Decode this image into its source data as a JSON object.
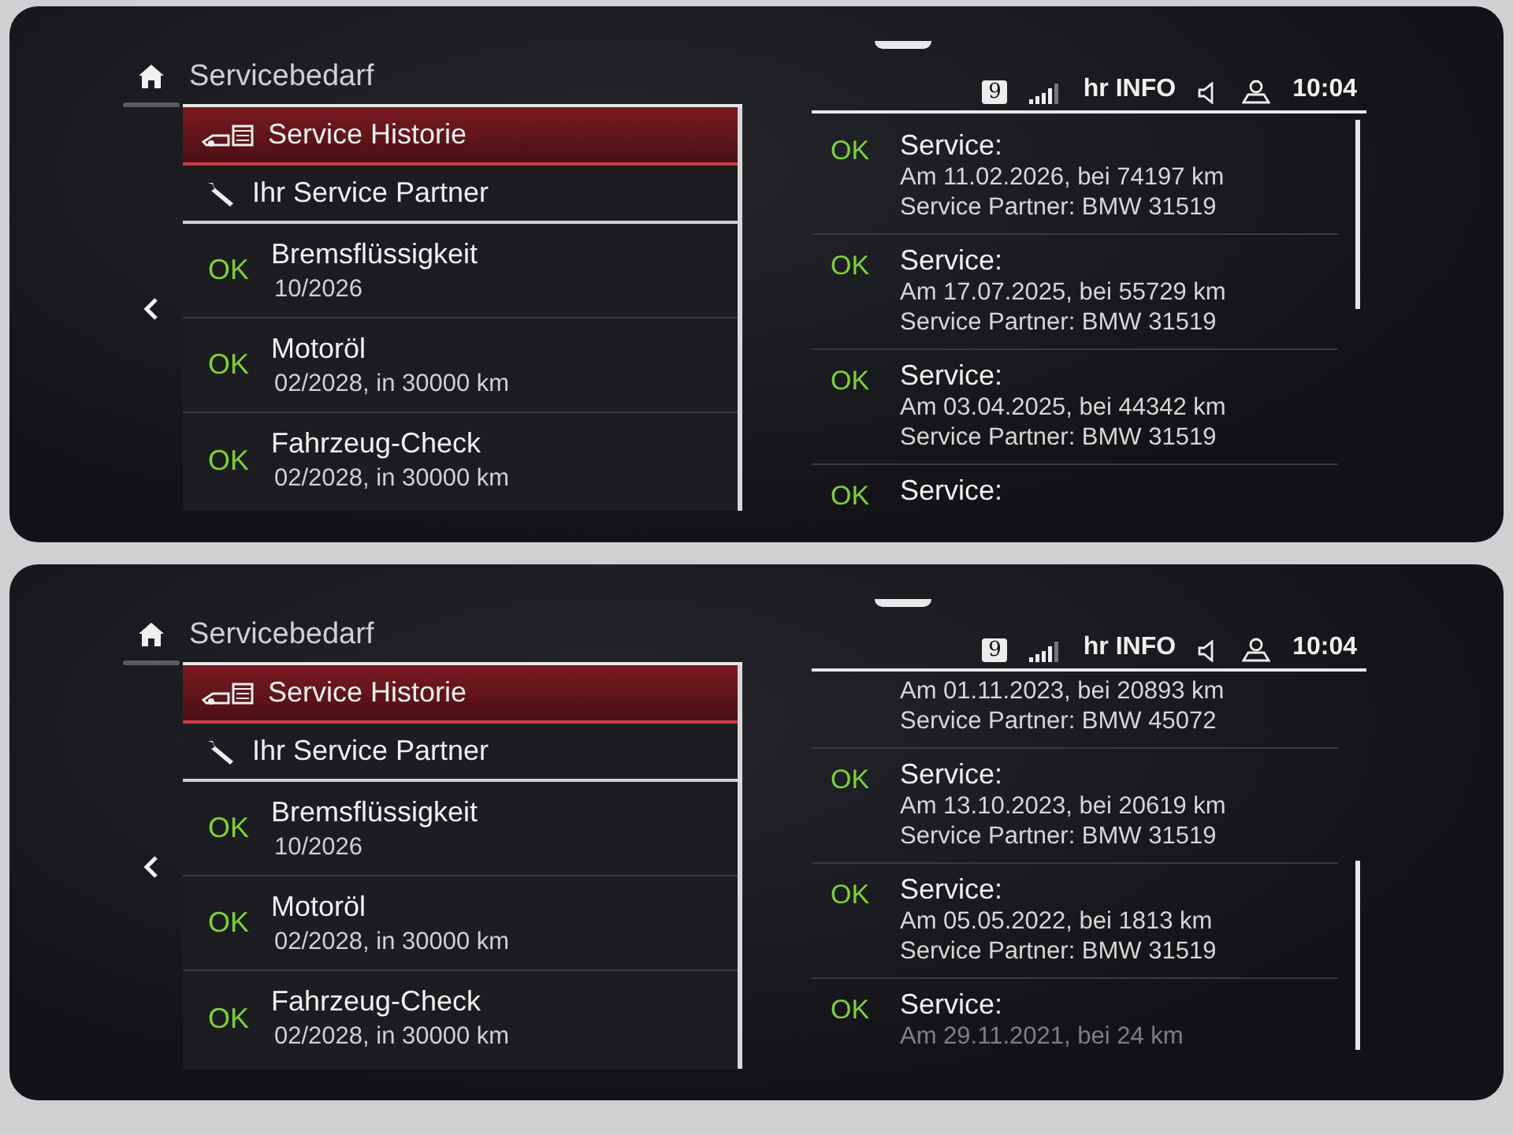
{
  "screens": [
    {
      "title": "Servicebedarf",
      "status_bar": {
        "channel": "9",
        "station": "hr INFO",
        "time": "10:04"
      },
      "menu": [
        {
          "label": "Service Historie",
          "kind": "history",
          "selected": true
        },
        {
          "label": "Ihr Service Partner",
          "kind": "partner",
          "selected": false
        }
      ],
      "services": [
        {
          "status": "OK",
          "name": "Bremsflüssigkeit",
          "due": "10/2026"
        },
        {
          "status": "OK",
          "name": "Motoröl",
          "due": "02/2028, in 30000 km"
        },
        {
          "status": "OK",
          "name": "Fahrzeug-Check",
          "due": "02/2028, in 30000 km"
        }
      ],
      "history": [
        {
          "status": "OK",
          "title": "Service:",
          "lines": [
            "Am 11.02.2026, bei 74197 km",
            "Service Partner: BMW 31519"
          ]
        },
        {
          "status": "OK",
          "title": "Service:",
          "lines": [
            "Am 17.07.2025, bei 55729 km",
            "Service Partner: BMW 31519"
          ]
        },
        {
          "status": "OK",
          "title": "Service:",
          "lines": [
            "Am 03.04.2025, bei 44342 km",
            "Service Partner: BMW 31519"
          ]
        },
        {
          "status": "OK",
          "title": "Service:"
        }
      ]
    },
    {
      "title": "Servicebedarf",
      "status_bar": {
        "channel": "9",
        "station": "hr INFO",
        "time": "10:04"
      },
      "menu": [
        {
          "label": "Service Historie",
          "kind": "history",
          "selected": true
        },
        {
          "label": "Ihr Service Partner",
          "kind": "partner",
          "selected": false
        }
      ],
      "services": [
        {
          "status": "OK",
          "name": "Bremsflüssigkeit",
          "due": "10/2026"
        },
        {
          "status": "OK",
          "name": "Motoröl",
          "due": "02/2028, in 30000 km"
        },
        {
          "status": "OK",
          "name": "Fahrzeug-Check",
          "due": "02/2028, in 30000 km"
        }
      ],
      "history": [
        {
          "lines": [
            "Am 01.11.2023, bei 20893 km",
            "Service Partner: BMW 45072"
          ]
        },
        {
          "status": "OK",
          "title": "Service:",
          "lines": [
            "Am 13.10.2023, bei 20619 km",
            "Service Partner: BMW 31519"
          ]
        },
        {
          "status": "OK",
          "title": "Service:",
          "lines": [
            "Am 05.05.2022, bei 1813 km",
            "Service Partner: BMW 31519"
          ]
        },
        {
          "status": "OK",
          "title": "Service:",
          "lines": [
            "Am 29.11.2021, bei 24 km"
          ]
        }
      ]
    }
  ]
}
